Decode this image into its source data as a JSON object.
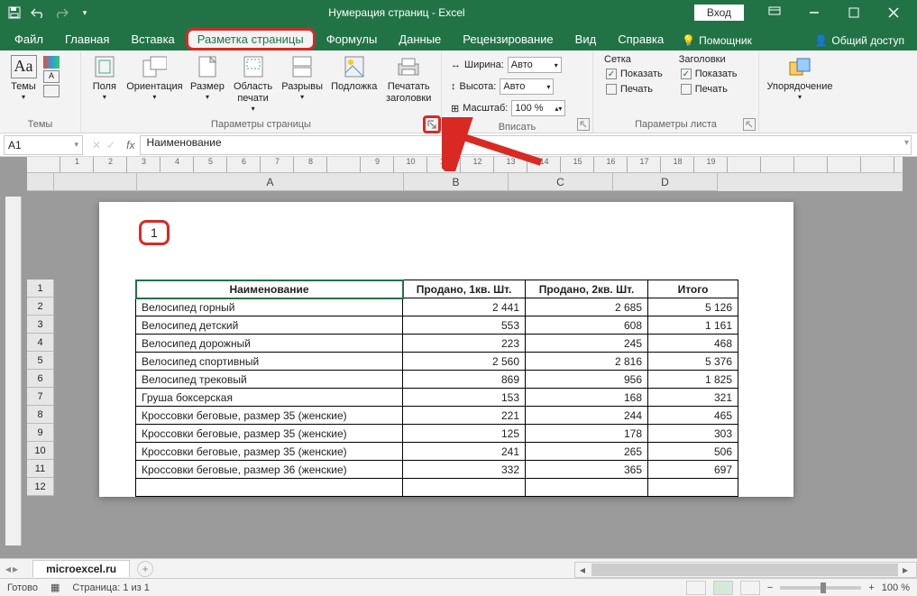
{
  "titlebar": {
    "title": "Нумерация страниц  -  Excel",
    "signin": "Вход"
  },
  "tabs": {
    "file": "Файл",
    "home": "Главная",
    "insert": "Вставка",
    "layout": "Разметка страницы",
    "formulas": "Формулы",
    "data": "Данные",
    "review": "Рецензирование",
    "view": "Вид",
    "help": "Справка",
    "tell": "Помощник",
    "share": "Общий доступ"
  },
  "ribbon": {
    "themes": {
      "Aa": "Aa",
      "label": "Темы",
      "group": "Темы"
    },
    "page_setup": {
      "margins": "Поля",
      "orientation": "Ориентация",
      "size": "Размер",
      "print_area": "Область печати",
      "breaks": "Разрывы",
      "background": "Подложка",
      "print_titles": "Печатать заголовки",
      "group": "Параметры страницы"
    },
    "scale": {
      "width_lbl": "Ширина:",
      "height_lbl": "Высота:",
      "scale_lbl": "Масштаб:",
      "width_val": "Авто",
      "height_val": "Авто",
      "scale_val": "100 %",
      "group": "Вписать"
    },
    "sheet_opts": {
      "grid_hdr": "Сетка",
      "headings_hdr": "Заголовки",
      "view": "Показать",
      "print": "Печать",
      "group": "Параметры листа"
    },
    "arrange": {
      "label": "Упорядочение",
      "group": ""
    }
  },
  "fbar": {
    "namebox": "A1",
    "formula": "Наименование"
  },
  "colheaders": [
    "A",
    "B",
    "C",
    "D"
  ],
  "rownums": [
    "1",
    "2",
    "3",
    "4",
    "5",
    "6",
    "7",
    "8",
    "9",
    "10",
    "11",
    "12"
  ],
  "page_number": "1",
  "table": {
    "headers": [
      "Наименование",
      "Продано, 1кв. Шт.",
      "Продано, 2кв. Шт.",
      "Итого"
    ],
    "rows": [
      [
        "Велосипед горный",
        "2 441",
        "2 685",
        "5 126"
      ],
      [
        "Велосипед детский",
        "553",
        "608",
        "1 161"
      ],
      [
        "Велосипед дорожный",
        "223",
        "245",
        "468"
      ],
      [
        "Велосипед спортивный",
        "2 560",
        "2 816",
        "5 376"
      ],
      [
        "Велосипед трековый",
        "869",
        "956",
        "1 825"
      ],
      [
        "Груша боксерская",
        "153",
        "168",
        "321"
      ],
      [
        "Кроссовки беговые, размер 35 (женские)",
        "221",
        "244",
        "465"
      ],
      [
        "Кроссовки беговые, размер 35 (женские)",
        "125",
        "178",
        "303"
      ],
      [
        "Кроссовки беговые, размер 35 (женские)",
        "241",
        "265",
        "506"
      ],
      [
        "Кроссовки беговые, размер 36 (женские)",
        "332",
        "365",
        "697"
      ],
      [
        "",
        "",
        "",
        ""
      ]
    ]
  },
  "sheet": {
    "name": "microexcel.ru"
  },
  "status": {
    "ready": "Готово",
    "page": "Страница: 1 из 1",
    "zoom": "100 %"
  },
  "ruler_numbers": [
    "",
    "1",
    "2",
    "3",
    "4",
    "5",
    "6",
    "7",
    "8",
    "",
    "9",
    "10",
    "11",
    "12",
    "13",
    "14",
    "15",
    "16",
    "17",
    "18",
    "19"
  ]
}
